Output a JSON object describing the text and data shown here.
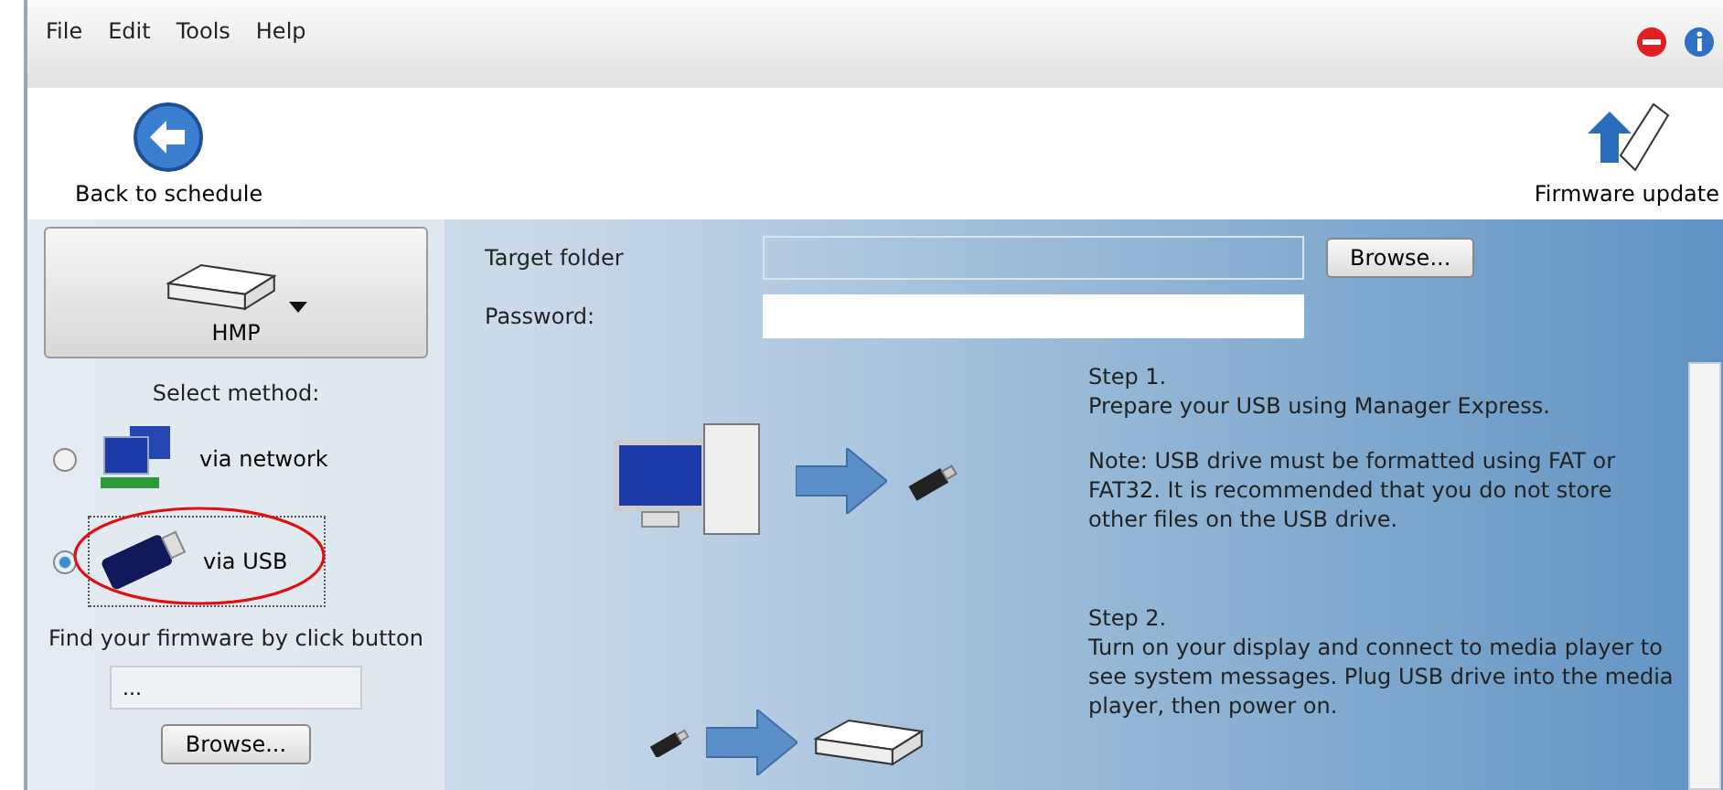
{
  "menu": [
    "File",
    "Edit",
    "Tools",
    "Help"
  ],
  "toolbar": {
    "back": "Back to schedule",
    "update": "Firmware update"
  },
  "device": {
    "label": "HMP"
  },
  "method": {
    "title": "Select method:",
    "options": [
      {
        "label": "via network",
        "kind": "network",
        "selected": false
      },
      {
        "label": "via USB",
        "kind": "usb",
        "selected": true
      }
    ]
  },
  "firmware": {
    "label": "Find your firmware by click button",
    "value": "...",
    "button": "Browse..."
  },
  "form": {
    "target_label": "Target folder",
    "password_label": "Password:",
    "button": "Browse..."
  },
  "steps": [
    {
      "title": "Step 1.",
      "paragraphs": [
        "Prepare your USB using Manager Express.",
        "Note: USB drive must be formatted using FAT or FAT32. It is recommended that you do not store other files on the USB drive."
      ]
    },
    {
      "title": "Step 2.",
      "paragraphs": [
        "Turn on your display and connect to media player to see system messages. Plug USB drive into the media player, then power on."
      ]
    }
  ]
}
